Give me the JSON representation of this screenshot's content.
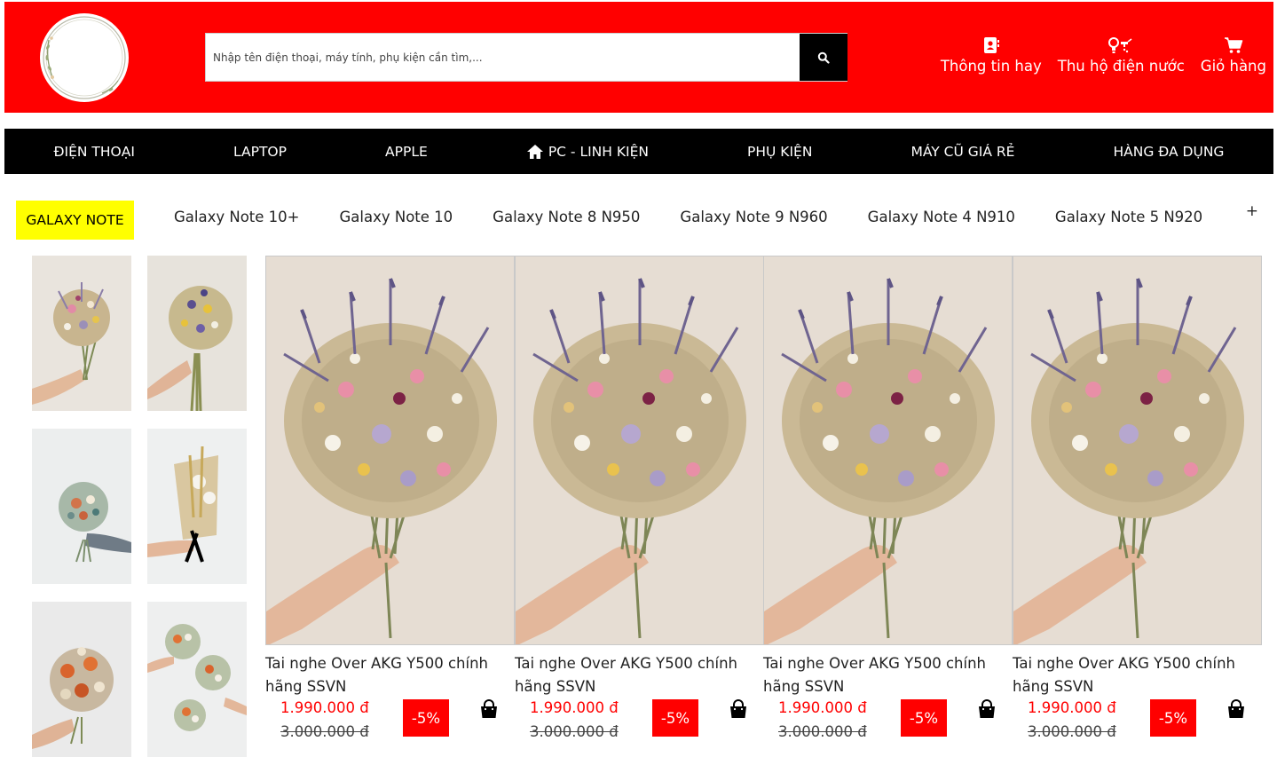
{
  "header": {
    "search_placeholder": "Nhập tên điện thoại, máy tính, phụ kiện cần tìm,...",
    "links": [
      {
        "label": "Thông tin hay",
        "icon": "contact-card-icon"
      },
      {
        "label": "Thu hộ điện nước",
        "icon": "bulb-faucet-icon"
      },
      {
        "label": "Giỏ hàng",
        "icon": "shopping-cart-icon"
      }
    ]
  },
  "nav": {
    "items": [
      "ĐIỆN THOẠI",
      "LAPTOP",
      "APPLE",
      "PC - LINH KIỆN",
      "PHỤ KIỆN",
      "MÁY CŨ GIÁ RẺ",
      "HÀNG ĐA DỤNG"
    ]
  },
  "subnav": {
    "title": "GALAXY NOTE",
    "items": [
      "Galaxy Note 10+",
      "Galaxy Note 10",
      "Galaxy Note 8 N950",
      "Galaxy Note 9 N960",
      "Galaxy Note 4 N910",
      "Galaxy Note 5 N920"
    ],
    "more": "+"
  },
  "products": [
    {
      "name": "Tai nghe Over AKG Y500 chính hãng SSVN",
      "price": "1.990.000 đ",
      "old_price": "3.000.000 đ",
      "discount": "-5%"
    },
    {
      "name": "Tai nghe Over AKG Y500 chính hãng SSVN",
      "price": "1.990.000 đ",
      "old_price": "3.000.000 đ",
      "discount": "-5%"
    },
    {
      "name": "Tai nghe Over AKG Y500 chính hãng SSVN",
      "price": "1.990.000 đ",
      "old_price": "3.000.000 đ",
      "discount": "-5%"
    },
    {
      "name": "Tai nghe Over AKG Y500 chính hãng SSVN",
      "price": "1.990.000 đ",
      "old_price": "3.000.000 đ",
      "discount": "-5%"
    }
  ],
  "colors": {
    "header_bg": "#ff0000",
    "nav_bg": "#000000",
    "subnav_highlight": "#ffff00",
    "price": "#ff0000",
    "discount_bg": "#ff0000"
  }
}
